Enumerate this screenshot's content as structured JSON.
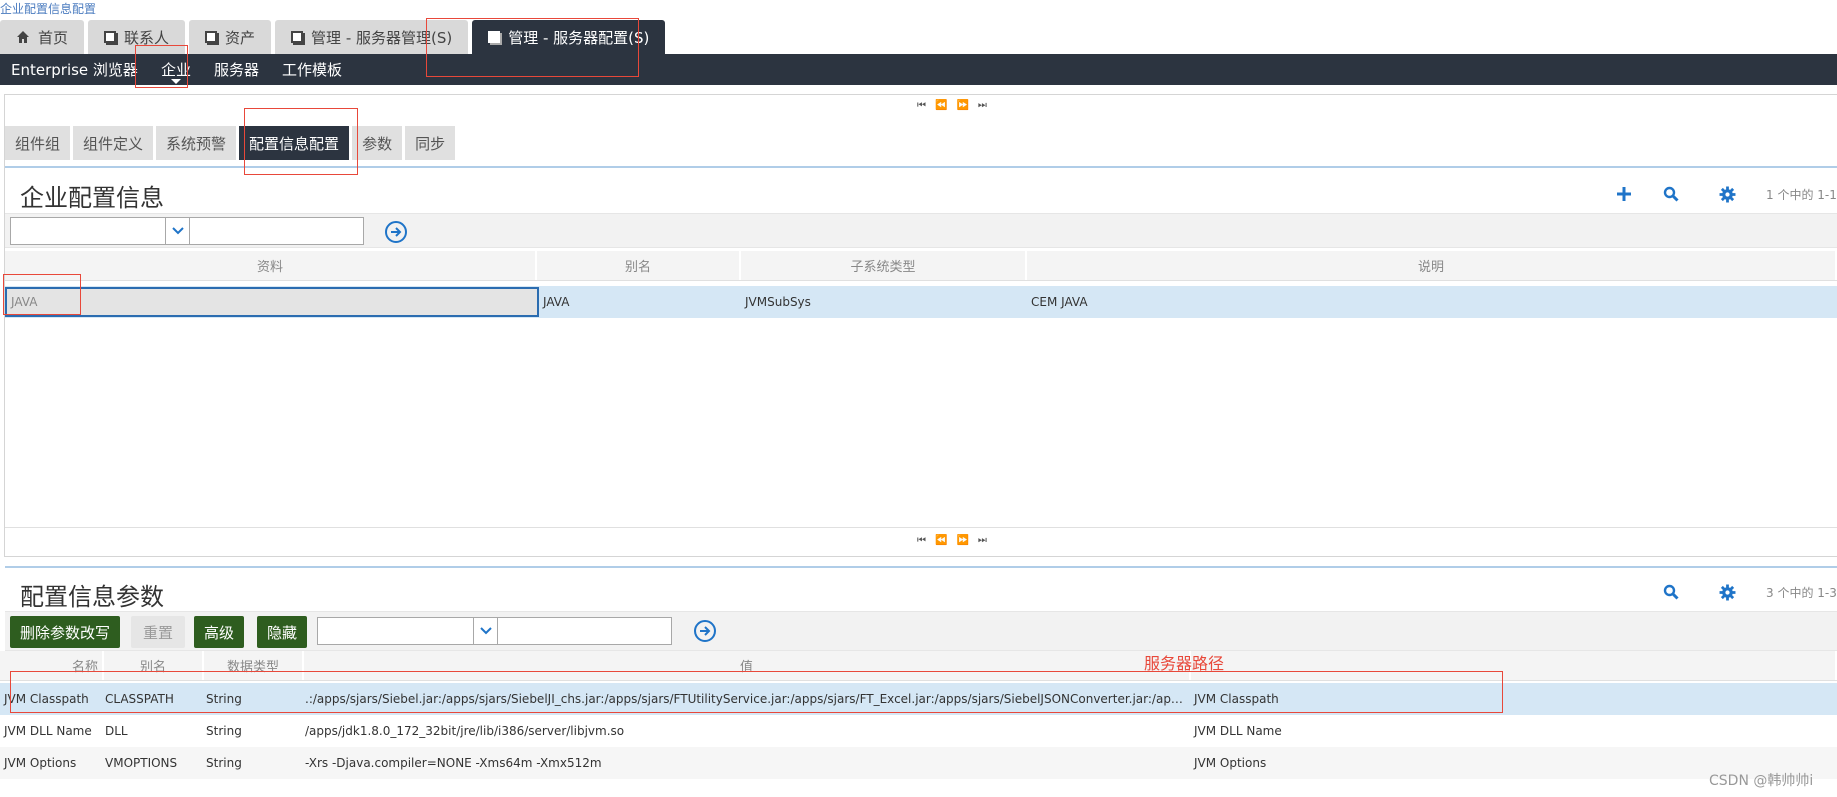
{
  "breadcrumb": "企业配置信息配置",
  "view_tabs": [
    {
      "label": "首页",
      "icon": "home-icon"
    },
    {
      "label": "联系人",
      "icon": "view-icon"
    },
    {
      "label": "资产",
      "icon": "view-icon"
    },
    {
      "label": "管理 - 服务器管理(S)",
      "icon": "view-icon"
    },
    {
      "label": "管理 - 服务器配置(S)",
      "icon": "view-icon"
    }
  ],
  "active_view_tab": 4,
  "nav": [
    "Enterprise 浏览器",
    "企业",
    "服务器",
    "工作模板"
  ],
  "sub_tabs": [
    "组件组",
    "组件定义",
    "系统预警",
    "配置信息配置",
    "参数",
    "同步"
  ],
  "top_applet": {
    "title": "企业配置信息",
    "count": "1 个中的 1-1",
    "columns": [
      "资料",
      "别名",
      "子系统类型",
      "说明"
    ],
    "rows": [
      {
        "profile": "JAVA",
        "alias": "JAVA",
        "subsystem": "JVMSubSys",
        "description": "CEM JAVA"
      }
    ]
  },
  "bottom_applet": {
    "title": "配置信息参数",
    "count": "3 个中的 1-3",
    "buttons": [
      "删除参数改写",
      "重置",
      "高级",
      "隐藏"
    ],
    "columns": [
      "名称",
      "别名",
      "数据类型",
      "值"
    ],
    "annotation": "服务器路径",
    "rows": [
      {
        "name": "JVM Classpath",
        "alias": "CLASSPATH",
        "type": "String",
        "value": ".:/apps/sjars/Siebel.jar:/apps/sjars/SiebelJI_chs.jar:/apps/sjars/FTUtilityService.jar:/apps/sjars/FT_Excel.jar:/apps/sjars/SiebelJSONConverter.jar:/ap…",
        "description": "JVM Classpath"
      },
      {
        "name": "JVM DLL Name",
        "alias": "DLL",
        "type": "String",
        "value": "/apps/jdk1.8.0_172_32bit/jre/lib/i386/server/libjvm.so",
        "description": "JVM DLL Name"
      },
      {
        "name": "JVM Options",
        "alias": "VMOPTIONS",
        "type": "String",
        "value": "-Xrs -Djava.compiler=NONE -Xms64m -Xmx512m",
        "description": "JVM Options"
      }
    ]
  },
  "pager_symbols": "⏮⏪⏩⏭",
  "watermark": "CSDN @韩帅帅i",
  "colors": {
    "nav_bg": "#2c3440",
    "accent": "#1f74c8",
    "annotation": "#e8483a",
    "selected_row": "#d5e7f5"
  }
}
